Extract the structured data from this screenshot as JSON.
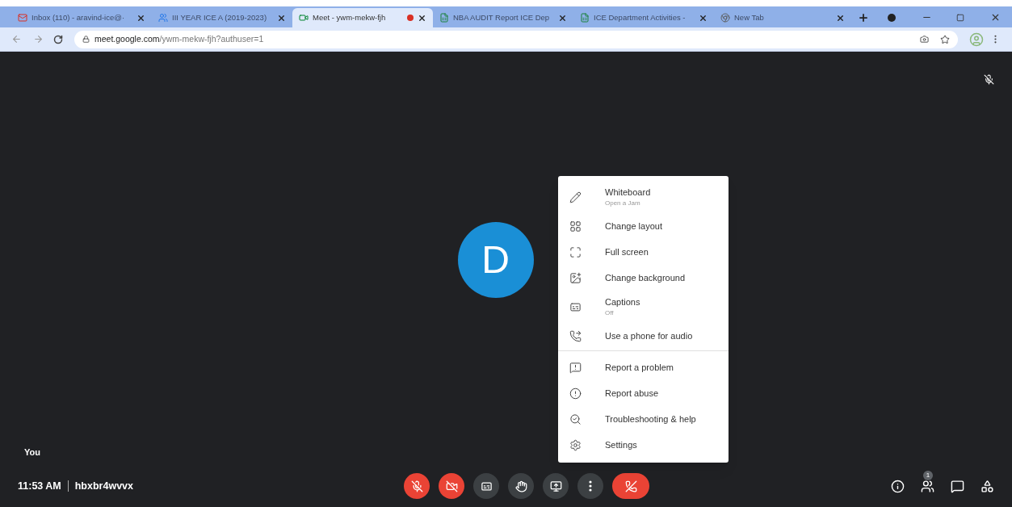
{
  "browser": {
    "tabs": [
      {
        "title": "Inbox (110) - aravind-ice@·",
        "kind": "mail",
        "selected": false,
        "recording": false
      },
      {
        "title": "III YEAR ICE A (2019-2023)",
        "kind": "class",
        "selected": false,
        "recording": false
      },
      {
        "title": "Meet - ywm-mekw-fjh",
        "kind": "meet",
        "selected": true,
        "recording": true
      },
      {
        "title": "NBA AUDIT Report ICE Dep",
        "kind": "sheet",
        "selected": false,
        "recording": false
      },
      {
        "title": "ICE Department Activities -",
        "kind": "sheet",
        "selected": false,
        "recording": false
      },
      {
        "title": "New Tab",
        "kind": "chrome",
        "selected": false,
        "recording": false
      }
    ],
    "url_host": "meet.google.com",
    "url_path": "/ywm-mekw-fjh?authuser=1"
  },
  "participant": {
    "initial": "D",
    "name": "You",
    "muted": true
  },
  "menu": {
    "groups": [
      [
        {
          "label": "Whiteboard",
          "sublabel": "Open a Jam"
        },
        {
          "label": "Change layout"
        },
        {
          "label": "Full screen"
        },
        {
          "label": "Change background"
        },
        {
          "label": "Captions",
          "sublabel": "Off"
        },
        {
          "label": "Use a phone for audio"
        }
      ],
      [
        {
          "label": "Report a problem"
        },
        {
          "label": "Report abuse"
        },
        {
          "label": "Troubleshooting & help"
        },
        {
          "label": "Settings"
        }
      ]
    ]
  },
  "footer": {
    "time": "11:53 AM",
    "meeting_code": "hbxbr4wvvx"
  },
  "controls": [
    {
      "kind": "mic",
      "on": false
    },
    {
      "kind": "camera",
      "on": false
    },
    {
      "kind": "captions",
      "on": false
    },
    {
      "kind": "hand",
      "on": false
    },
    {
      "kind": "present",
      "on": false
    },
    {
      "kind": "more",
      "on": false
    },
    {
      "kind": "end"
    }
  ],
  "side_controls": {
    "participants_badge": "1"
  }
}
